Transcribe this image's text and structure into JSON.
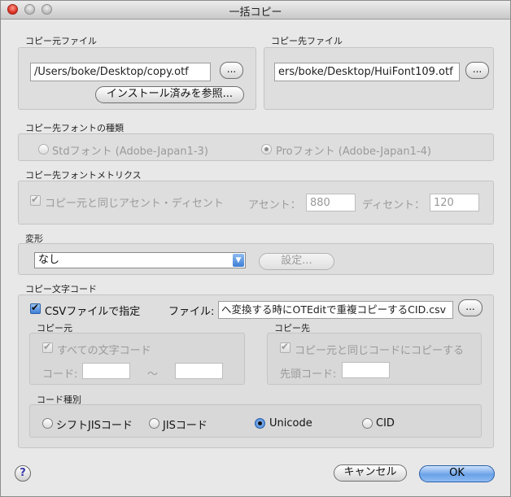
{
  "window": {
    "title": "一括コピー"
  },
  "source_file": {
    "label": "コピー元ファイル",
    "path": "/Users/boke/Desktop/copy.otf",
    "browse_label": "...",
    "installed_button": "インストール済みを参照..."
  },
  "dest_file": {
    "label": "コピー先ファイル",
    "path": "ers/boke/Desktop/HuiFont109.otf",
    "browse_label": "..."
  },
  "font_type": {
    "label": "コピー先フォントの種類",
    "std": "Stdフォント (Adobe-Japan1-3)",
    "pro": "Proフォント (Adobe-Japan1-4)",
    "selected": "pro"
  },
  "metrics": {
    "label": "コピー先フォントメトリクス",
    "same_checkbox": "コピー元と同じアセント・ディセント",
    "ascent_label": "アセント：",
    "ascent_value": "880",
    "descent_label": "ディセント：",
    "descent_value": "120"
  },
  "transform": {
    "label": "変形",
    "selected": "なし",
    "settings_button": "設定..."
  },
  "char_code": {
    "label": "コピー文字コード",
    "csv_checkbox": "CSVファイルで指定",
    "file_label": "ファイル:",
    "file_value": "へ変換する時にOTEditで重複コピーするCID.csv",
    "browse_label": "...",
    "source": {
      "label": "コピー元",
      "all_checkbox": "すべての文字コード",
      "code_label": "コード:",
      "tilde": "〜"
    },
    "dest": {
      "label": "コピー先",
      "same_checkbox": "コピー元と同じコードにコピーする",
      "start_label": "先頭コード:"
    },
    "code_type": {
      "label": "コード種別",
      "options": [
        "シフトJISコード",
        "JISコード",
        "Unicode",
        "CID"
      ],
      "selected": "Unicode"
    }
  },
  "footer": {
    "help": "?",
    "cancel": "キャンセル",
    "ok": "OK"
  },
  "colors": {
    "accent": "#3e7fd6",
    "window_bg": "#e8e8e8"
  }
}
